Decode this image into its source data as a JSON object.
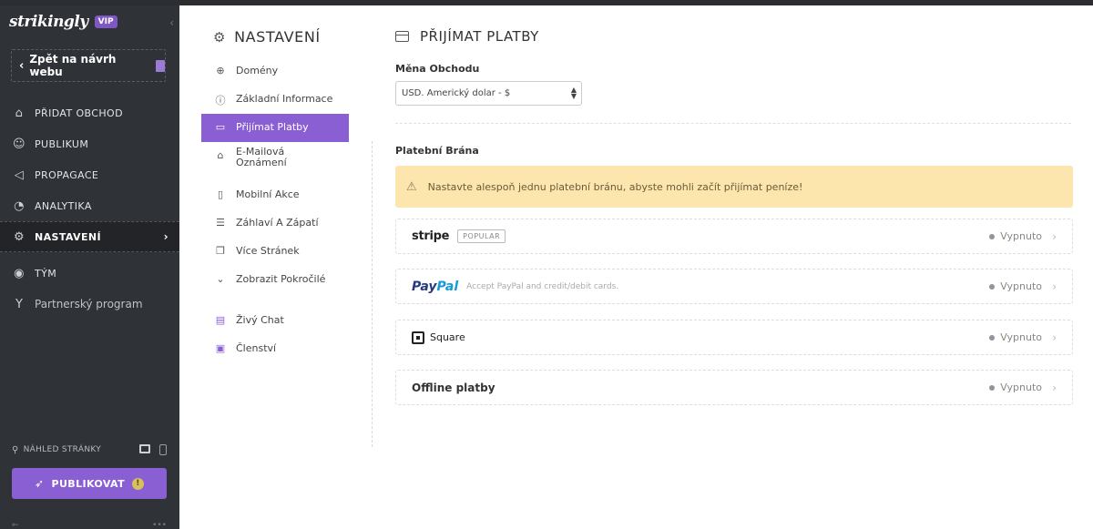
{
  "sidebar": {
    "logo": "strikingly",
    "vip": "VIP",
    "back_label": "Zpět na návrh webu",
    "items": [
      {
        "label": "PŘIDAT OBCHOD",
        "icon": "store-icon"
      },
      {
        "label": "PUBLIKUM",
        "icon": "users-icon"
      },
      {
        "label": "PROPAGACE",
        "icon": "megaphone-icon"
      },
      {
        "label": "ANALYTIKA",
        "icon": "pie-chart-icon"
      },
      {
        "label": "NASTAVENÍ",
        "icon": "gear-icon"
      },
      {
        "label": "TÝM",
        "icon": "team-icon"
      },
      {
        "label": "Partnerský program",
        "icon": "cocktail-icon"
      }
    ],
    "preview_label": "NÁHLED STRÁNKY",
    "publish_label": "PUBLIKOVAT",
    "publish_warning": "!"
  },
  "subnav": {
    "title": "NASTAVENÍ",
    "items": [
      {
        "label": "Domény",
        "icon": "globe-icon"
      },
      {
        "label": "Základní Informace",
        "icon": "info-icon"
      },
      {
        "label": "Přijímat Platby",
        "icon": "payment-card-icon"
      },
      {
        "label": "E-Mailová Oznámení",
        "icon": "bell-icon"
      },
      {
        "label": "Mobilní Akce",
        "icon": "mobile-icon"
      },
      {
        "label": "Záhlaví A Zápatí",
        "icon": "header-footer-icon"
      },
      {
        "label": "Více Stránek",
        "icon": "pages-icon"
      },
      {
        "label": "Zobrazit Pokročilé",
        "icon": "chevron-down-icon"
      },
      {
        "label": "Živý Chat",
        "icon": "chat-icon"
      },
      {
        "label": "Členství",
        "icon": "membership-icon"
      }
    ]
  },
  "main": {
    "title": "PŘIJÍMAT PLATBY",
    "currency_label": "Měna Obchodu",
    "currency_value": "USD. Americký dolar - $",
    "gateway_label": "Platební Brána",
    "alert": "Nastavte alespoň jednu platební bránu, abyste mohli začít přijímat peníze!",
    "gateways": [
      {
        "name": "stripe",
        "badge": "POPULAR",
        "status": "Vypnuto"
      },
      {
        "name_a": "Pay",
        "name_b": "Pal",
        "desc": "Accept PayPal and credit/debit cards.",
        "status": "Vypnuto"
      },
      {
        "name": "Square",
        "status": "Vypnuto"
      },
      {
        "name": "Offline platby",
        "status": "Vypnuto"
      }
    ]
  }
}
